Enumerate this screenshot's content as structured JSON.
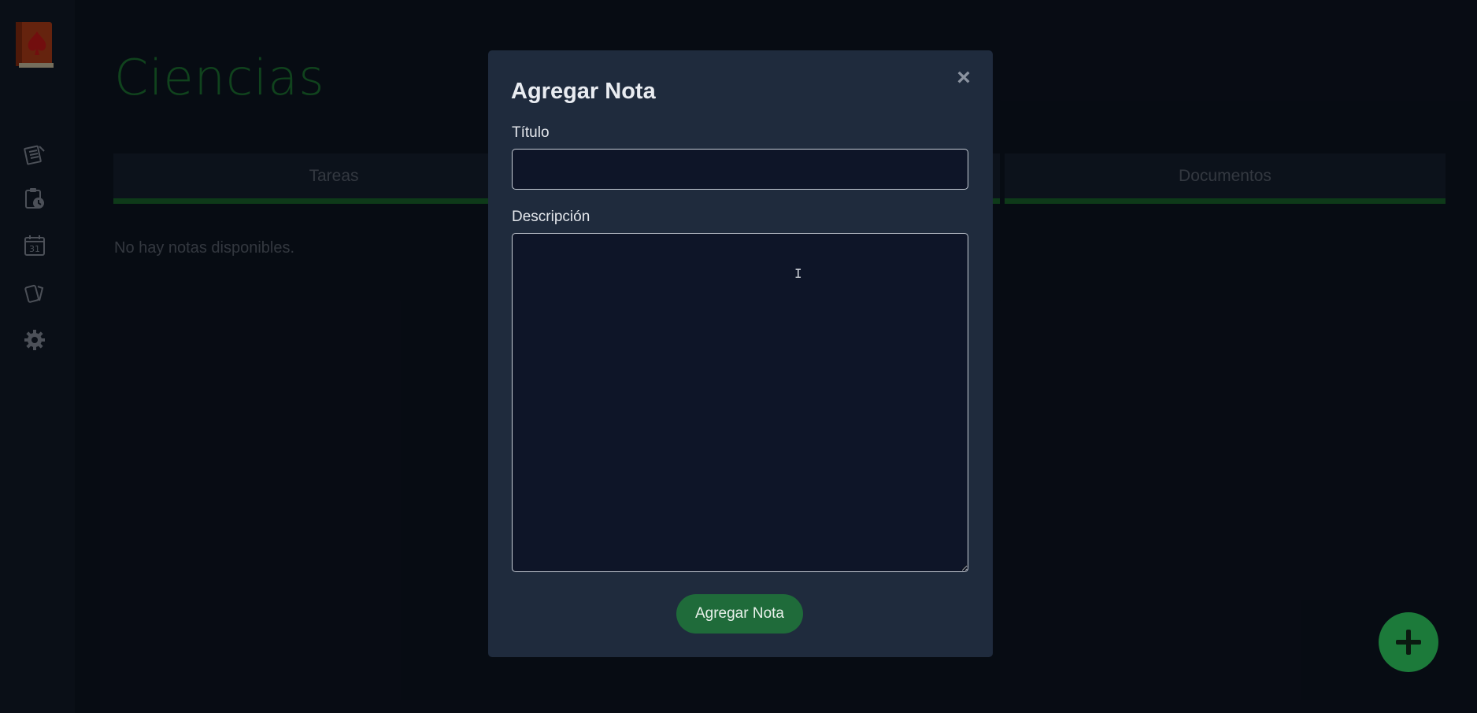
{
  "sidebar": {
    "logo": "spade-book-logo",
    "items": [
      {
        "icon": "notes-icon"
      },
      {
        "icon": "clipboard-clock-icon"
      },
      {
        "icon": "calendar-icon",
        "label": "31"
      },
      {
        "icon": "cards-icon"
      },
      {
        "icon": "gear-icon"
      }
    ]
  },
  "page": {
    "title": "Ciencias",
    "tabs": [
      {
        "label": "Tareas"
      },
      {
        "label": ""
      },
      {
        "label": "Documentos"
      }
    ],
    "empty_message": "No hay notas disponibles."
  },
  "modal": {
    "title": "Agregar Nota",
    "close_symbol": "×",
    "title_label": "Título",
    "title_value": "",
    "description_label": "Descripción",
    "description_value": "",
    "submit_label": "Agregar Nota"
  },
  "fab": {
    "icon": "plus-icon"
  },
  "colors": {
    "accent_green": "#1e7a35",
    "modal_bg": "#1f2b3d",
    "page_bg": "#0e1624"
  }
}
